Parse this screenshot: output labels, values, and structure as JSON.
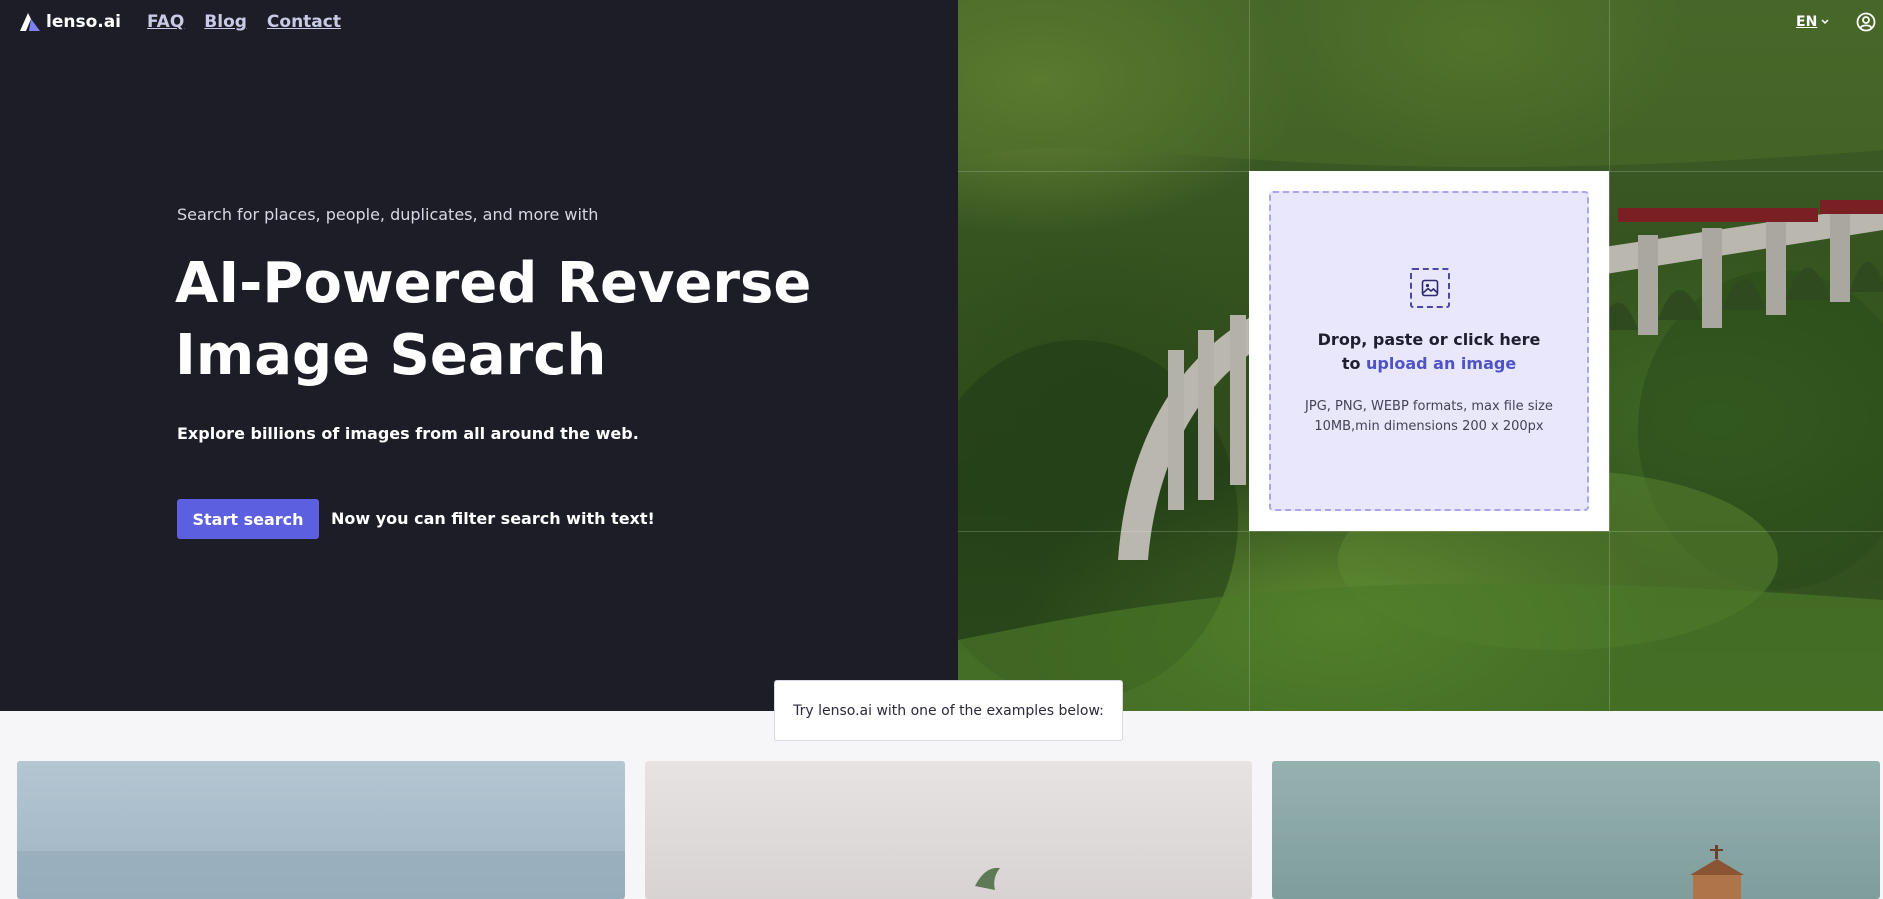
{
  "brand": {
    "name": "lenso.ai"
  },
  "nav": {
    "items": [
      "FAQ",
      "Blog",
      "Contact"
    ]
  },
  "header": {
    "language": "EN"
  },
  "hero": {
    "subtitle": "Search for places, people, duplicates, and more with",
    "title_line1": "AI-Powered Reverse",
    "title_line2": "Image Search",
    "description": "Explore billions of images from all around the web.",
    "cta_label": "Start search",
    "filter_note": "Now you can filter search with text!"
  },
  "upload": {
    "line1": "Drop, paste or click here",
    "line2_prefix": "to ",
    "line2_link": "upload an image",
    "formats_line1": "JPG, PNG, WEBP formats, max file size",
    "formats_line2": "10MB,min dimensions 200 x 200px"
  },
  "examples": {
    "label": "Try lenso.ai with one of the examples below:"
  },
  "colors": {
    "hero_bg": "#1d1d28",
    "accent": "#5b5fe0",
    "upload_bg": "#e8e7fc",
    "link": "#4f53c8"
  }
}
